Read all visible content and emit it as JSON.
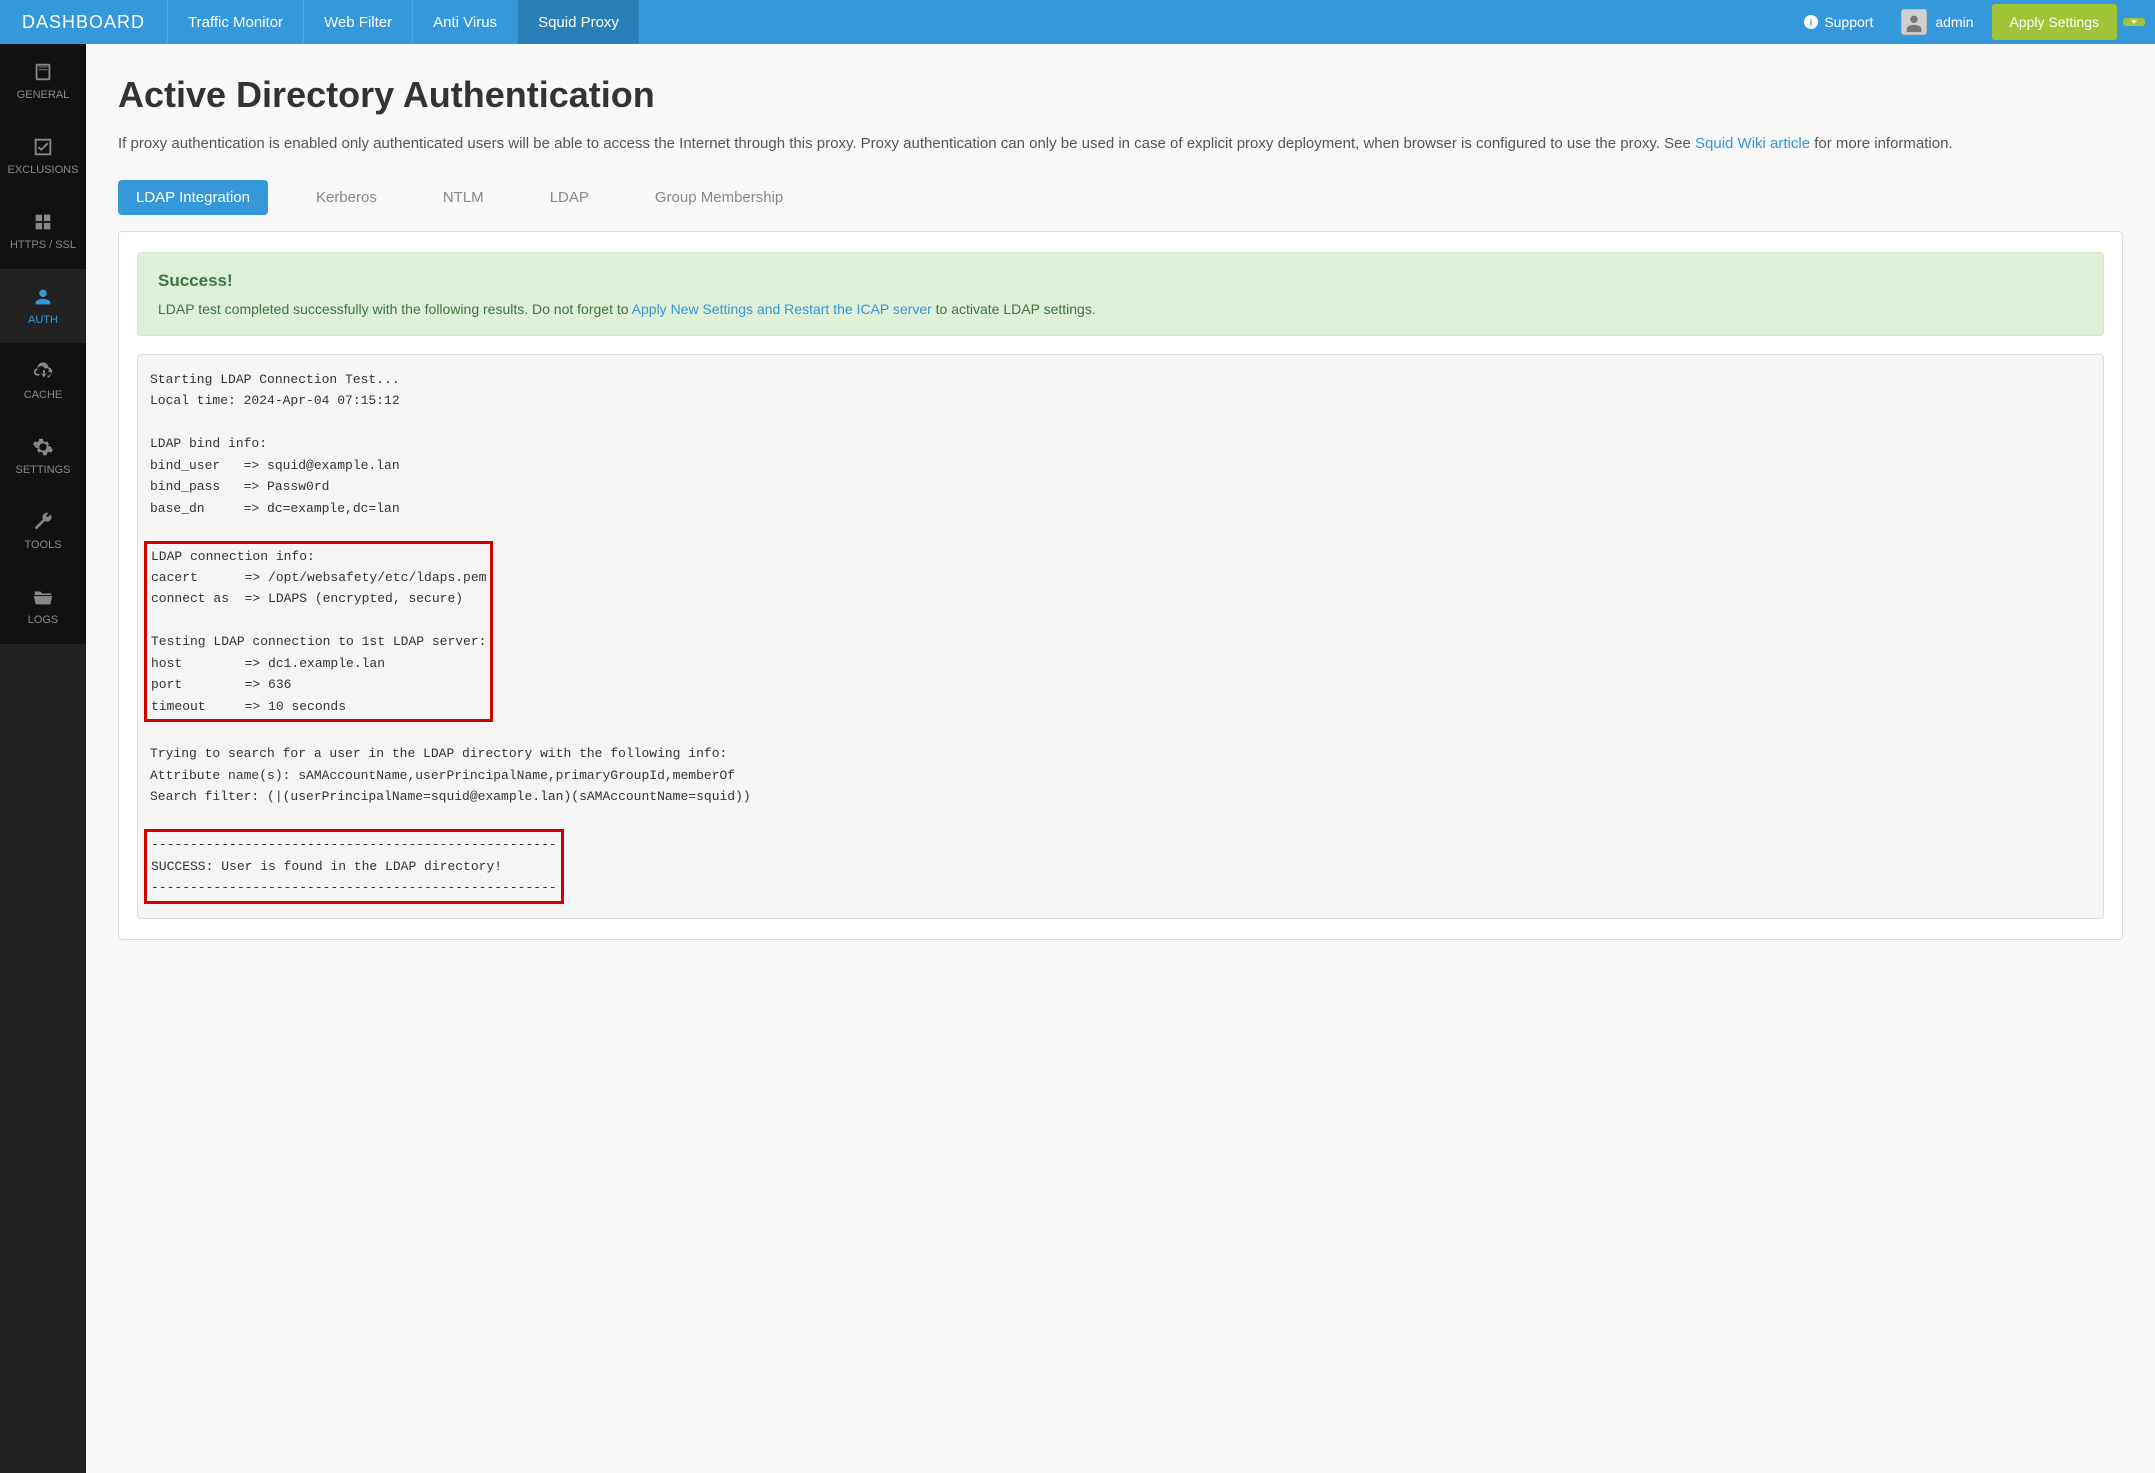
{
  "brand": "DASHBOARD",
  "topnav": {
    "items": [
      {
        "label": "Traffic Monitor"
      },
      {
        "label": "Web Filter"
      },
      {
        "label": "Anti Virus"
      },
      {
        "label": "Squid Proxy"
      }
    ],
    "support": "Support",
    "user": "admin",
    "apply": "Apply Settings"
  },
  "sidebar": {
    "items": [
      {
        "label": "GENERAL"
      },
      {
        "label": "EXCLUSIONS"
      },
      {
        "label": "HTTPS / SSL"
      },
      {
        "label": "AUTH"
      },
      {
        "label": "CACHE"
      },
      {
        "label": "SETTINGS"
      },
      {
        "label": "TOOLS"
      },
      {
        "label": "LOGS"
      }
    ]
  },
  "page": {
    "title": "Active Directory Authentication",
    "desc_pre": "If proxy authentication is enabled only authenticated users will be able to access the Internet through this proxy. Proxy authentication can only be used in case of explicit proxy deployment, when browser is configured to use the proxy. See ",
    "desc_link": "Squid Wiki article",
    "desc_post": " for more information."
  },
  "tabs": [
    {
      "label": "LDAP Integration"
    },
    {
      "label": "Kerberos"
    },
    {
      "label": "NTLM"
    },
    {
      "label": "LDAP"
    },
    {
      "label": "Group Membership"
    }
  ],
  "alert": {
    "heading": "Success!",
    "text_pre": "LDAP test completed successfully with the following results. Do not forget to ",
    "link": "Apply New Settings and Restart the ICAP server",
    "text_post": " to activate LDAP settings."
  },
  "console": {
    "block1": "Starting LDAP Connection Test...\nLocal time: 2024-Apr-04 07:15:12\n\nLDAP bind info:\nbind_user   => squid@example.lan\nbind_pass   => Passw0rd\nbase_dn     => dc=example,dc=lan",
    "block2": "LDAP connection info:\ncacert      => /opt/websafety/etc/ldaps.pem\nconnect as  => LDAPS (encrypted, secure)\n\nTesting LDAP connection to 1st LDAP server:\nhost        => dc1.example.lan\nport        => 636\ntimeout     => 10 seconds",
    "block3": "Trying to search for a user in the LDAP directory with the following info:\nAttribute name(s): sAMAccountName,userPrincipalName,primaryGroupId,memberOf\nSearch filter: (|(userPrincipalName=squid@example.lan)(sAMAccountName=squid))",
    "block4": "----------------------------------------------------\nSUCCESS: User is found in the LDAP directory!\n----------------------------------------------------"
  }
}
